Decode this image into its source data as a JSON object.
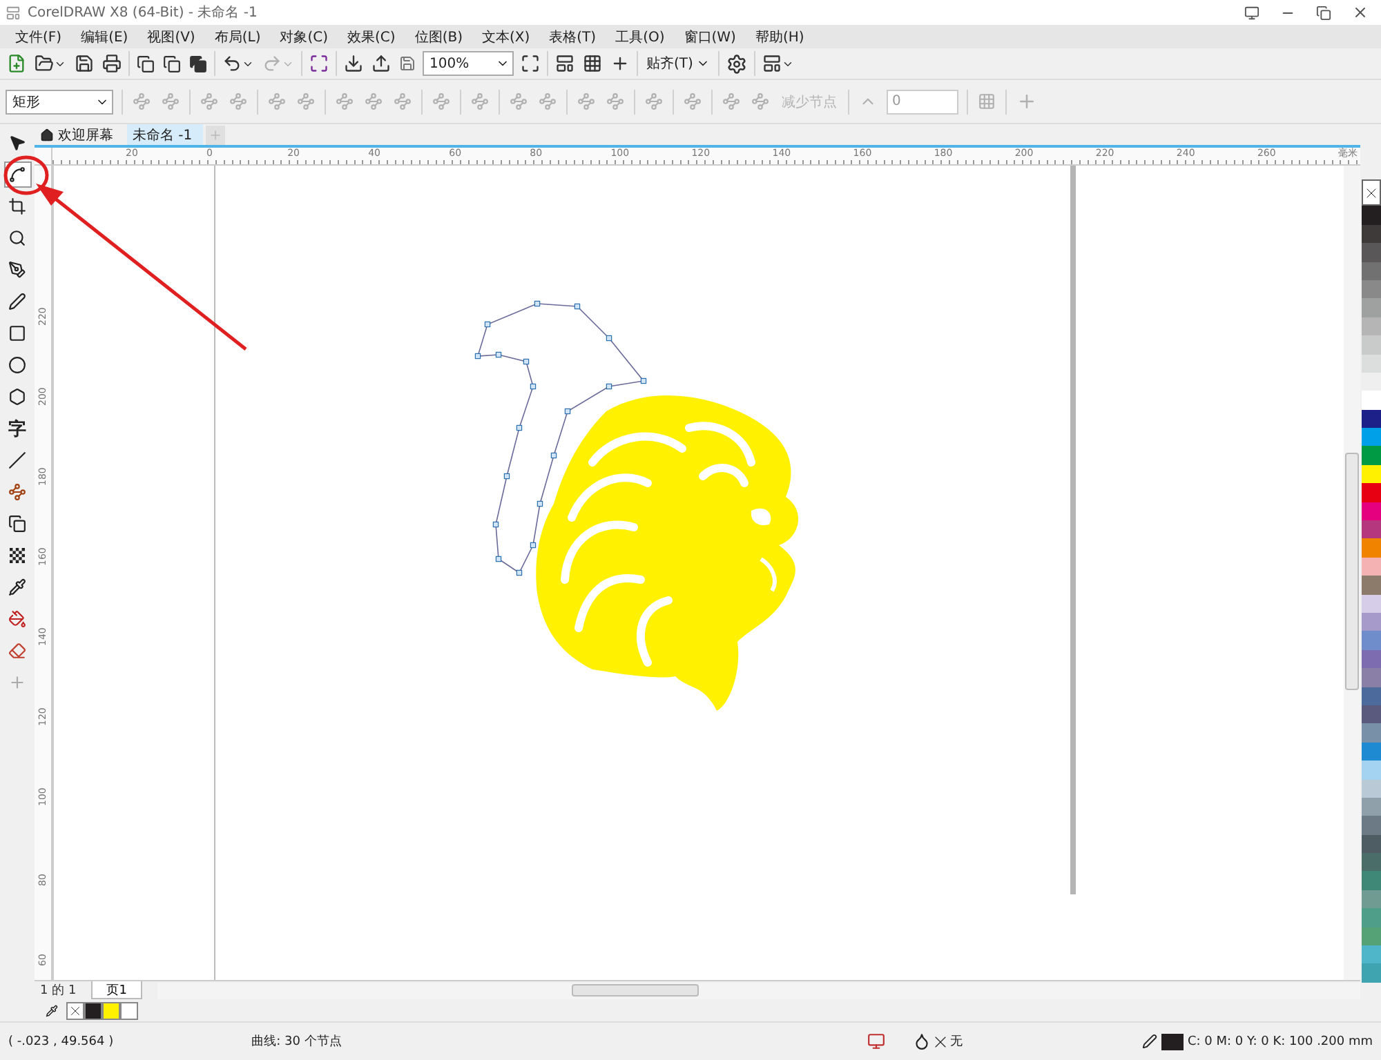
{
  "window": {
    "title": "CorelDRAW X8 (64-Bit) - 未命名 -1"
  },
  "menu": [
    "文件(F)",
    "编辑(E)",
    "视图(V)",
    "布局(L)",
    "对象(C)",
    "效果(C)",
    "位图(B)",
    "文本(X)",
    "表格(T)",
    "工具(O)",
    "窗口(W)",
    "帮助(H)"
  ],
  "toolbar": {
    "zoom": "100%",
    "snap": "贴齐(T)"
  },
  "property_bar": {
    "shape_select": "矩形",
    "reduce_nodes": {
      "label": "减少节点",
      "disabled": true
    },
    "smoothness": "0"
  },
  "toolbox": [
    {
      "kind": "pick",
      "selected": false
    },
    {
      "kind": "shape",
      "selected": true
    },
    {
      "kind": "crop",
      "selected": false
    },
    {
      "kind": "zoom",
      "selected": false
    },
    {
      "kind": "pen",
      "selected": false
    },
    {
      "kind": "curve",
      "selected": false
    },
    {
      "kind": "rectangle",
      "selected": false
    },
    {
      "kind": "ellipse",
      "selected": false
    },
    {
      "kind": "polygon",
      "selected": false
    },
    {
      "kind": "text",
      "glyph": "字",
      "selected": false
    },
    {
      "kind": "line",
      "selected": false
    },
    {
      "kind": "connector",
      "selected": false
    },
    {
      "kind": "shadow",
      "selected": false
    },
    {
      "kind": "transparency",
      "selected": false
    },
    {
      "kind": "eyedropper",
      "selected": false
    },
    {
      "kind": "fill",
      "selected": false
    },
    {
      "kind": "smartfill",
      "selected": false
    },
    {
      "kind": "add",
      "selected": false
    }
  ],
  "tabs": [
    {
      "label": "欢迎屏幕",
      "selected": false
    },
    {
      "label": "未命名 -1",
      "selected": true
    }
  ],
  "ruler": {
    "h_labels": [
      "20",
      "0",
      "20",
      "40",
      "60",
      "80",
      "100",
      "120",
      "140",
      "160",
      "180",
      "200",
      "220",
      "240",
      "260"
    ],
    "unit": "毫米",
    "v_labels": [
      "220",
      "200",
      "180",
      "160",
      "140",
      "120",
      "100",
      "80",
      "60"
    ]
  },
  "page_nav": {
    "position": "1 的 1",
    "page_tab": "页1"
  },
  "document_palette": [
    {
      "kind": "none"
    },
    {
      "kind": "swatch",
      "color": "#231f20"
    },
    {
      "kind": "swatch",
      "color": "#fff100"
    },
    {
      "kind": "swatch",
      "color": "#ffffff"
    }
  ],
  "palette": [
    {
      "kind": "none"
    },
    {
      "kind": "swatch",
      "color": "#231f20"
    },
    {
      "kind": "swatch",
      "color": "#3e3a39"
    },
    {
      "kind": "swatch",
      "color": "#595757"
    },
    {
      "kind": "swatch",
      "color": "#727171"
    },
    {
      "kind": "swatch",
      "color": "#898989"
    },
    {
      "kind": "swatch",
      "color": "#9fa0a0"
    },
    {
      "kind": "swatch",
      "color": "#b5b5b6"
    },
    {
      "kind": "swatch",
      "color": "#c9caca"
    },
    {
      "kind": "swatch",
      "color": "#dcdddd"
    },
    {
      "kind": "swatch",
      "color": "#efefef"
    },
    {
      "kind": "swatch",
      "color": "#ffffff"
    },
    {
      "kind": "swatch",
      "color": "#1d2088"
    },
    {
      "kind": "swatch",
      "color": "#00a0e9"
    },
    {
      "kind": "swatch",
      "color": "#009944"
    },
    {
      "kind": "swatch",
      "color": "#fff100"
    },
    {
      "kind": "swatch",
      "color": "#e60012"
    },
    {
      "kind": "swatch",
      "color": "#e4007f"
    },
    {
      "kind": "swatch",
      "color": "#b5377d"
    },
    {
      "kind": "swatch",
      "color": "#f08300"
    },
    {
      "kind": "swatch",
      "color": "#f5b2b2"
    },
    {
      "kind": "swatch",
      "color": "#8c7a6b"
    },
    {
      "kind": "swatch",
      "color": "#d6cde8"
    },
    {
      "kind": "swatch",
      "color": "#a59aca"
    },
    {
      "kind": "swatch",
      "color": "#6f8ccb"
    },
    {
      "kind": "swatch",
      "color": "#7d6db0"
    },
    {
      "kind": "swatch",
      "color": "#8a7fa6"
    },
    {
      "kind": "swatch",
      "color": "#4c6a9b"
    },
    {
      "kind": "swatch",
      "color": "#5a5a7e"
    },
    {
      "kind": "swatch",
      "color": "#7891a8"
    },
    {
      "kind": "swatch",
      "color": "#1d8ad2"
    },
    {
      "kind": "swatch",
      "color": "#a3d3f0"
    },
    {
      "kind": "swatch",
      "color": "#b9c9d6"
    },
    {
      "kind": "swatch",
      "color": "#8fa0ab"
    },
    {
      "kind": "swatch",
      "color": "#6b7a84"
    },
    {
      "kind": "swatch",
      "color": "#4e5c63"
    },
    {
      "kind": "swatch",
      "color": "#4b6d6a"
    },
    {
      "kind": "swatch",
      "color": "#3f8878"
    },
    {
      "kind": "swatch",
      "color": "#6f9b93"
    },
    {
      "kind": "swatch",
      "color": "#4e9e8a"
    },
    {
      "kind": "swatch",
      "color": "#56a277"
    },
    {
      "kind": "swatch",
      "color": "#4fb5c9"
    },
    {
      "kind": "swatch",
      "color": "#40a3b0"
    }
  ],
  "status_bar": {
    "coordinates": "( -.023 , 49.564 )",
    "selection": "曲线: 30 个节点",
    "fill": "无",
    "outline": "C: 0 M: 0 Y: 0 K: 100 .200 mm"
  }
}
